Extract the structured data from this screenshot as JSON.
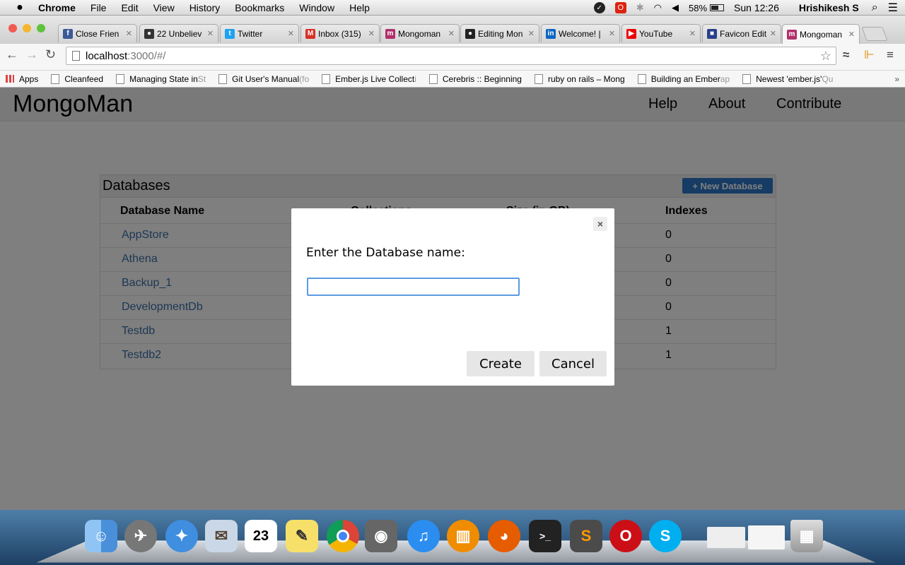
{
  "menubar": {
    "items": [
      "Chrome",
      "File",
      "Edit",
      "View",
      "History",
      "Bookmarks",
      "Window",
      "Help"
    ],
    "battery": "58%",
    "clock": "Sun 12:26",
    "user": "Hrishikesh S"
  },
  "tabs": [
    {
      "title": "Close Frien",
      "fav": "facebook-icon",
      "color": "#3b5998",
      "glyph": "f"
    },
    {
      "title": "22 Unbeliev",
      "fav": "site-icon",
      "color": "#333",
      "glyph": "●"
    },
    {
      "title": "Twitter",
      "fav": "twitter-icon",
      "color": "#1da1f2",
      "glyph": "t"
    },
    {
      "title": "Inbox (315)",
      "fav": "gmail-icon",
      "color": "#d93025",
      "glyph": "M"
    },
    {
      "title": "Mongoman",
      "fav": "mongoman-icon",
      "color": "#b0306a",
      "glyph": "m"
    },
    {
      "title": "Editing Mon",
      "fav": "github-icon",
      "color": "#222",
      "glyph": "●"
    },
    {
      "title": "Welcome! |",
      "fav": "linkedin-icon",
      "color": "#0a66c2",
      "glyph": "in"
    },
    {
      "title": "YouTube",
      "fav": "youtube-icon",
      "color": "#e00",
      "glyph": "▶"
    },
    {
      "title": "Favicon Edit",
      "fav": "favicon-editor-icon",
      "color": "#2a3f8a",
      "glyph": "■"
    },
    {
      "title": "Mongoman",
      "fav": "mongoman-icon",
      "color": "#b0306a",
      "glyph": "m"
    }
  ],
  "omnibox": {
    "host": "localhost",
    "path": ":3000/#/"
  },
  "bookmarks": [
    {
      "label": "Apps",
      "fade": ""
    },
    {
      "label": "Cleanfeed",
      "fade": ""
    },
    {
      "label": "Managing State in",
      "fade": " St"
    },
    {
      "label": "Git User's Manual",
      "fade": " (fo"
    },
    {
      "label": "Ember.js Live Collect",
      "fade": "i"
    },
    {
      "label": "Cerebris :: Beginning",
      "fade": ""
    },
    {
      "label": "ruby on rails – Mong",
      "fade": ""
    },
    {
      "label": "Building an Ember",
      "fade": " ap"
    },
    {
      "label": "Newest 'ember.js'",
      "fade": " Qu"
    }
  ],
  "app": {
    "brand": "MongoMan",
    "nav": [
      "Help",
      "About",
      "Contribute"
    ]
  },
  "panel": {
    "title": "Databases",
    "new_button": "+ New Database",
    "headers": [
      "Database Name",
      "Collections",
      "Size (in GB)",
      "Indexes"
    ],
    "rows": [
      {
        "name": "AppStore",
        "indexes": "0"
      },
      {
        "name": "Athena",
        "indexes": "0"
      },
      {
        "name": "Backup_1",
        "indexes": "0"
      },
      {
        "name": "DevelopmentDb",
        "indexes": "0"
      },
      {
        "name": "Testdb",
        "indexes": "1"
      },
      {
        "name": "Testdb2",
        "indexes": "1"
      }
    ]
  },
  "modal": {
    "label": "Enter the Database name:",
    "input_value": "",
    "create": "Create",
    "cancel": "Cancel",
    "close": "×"
  }
}
